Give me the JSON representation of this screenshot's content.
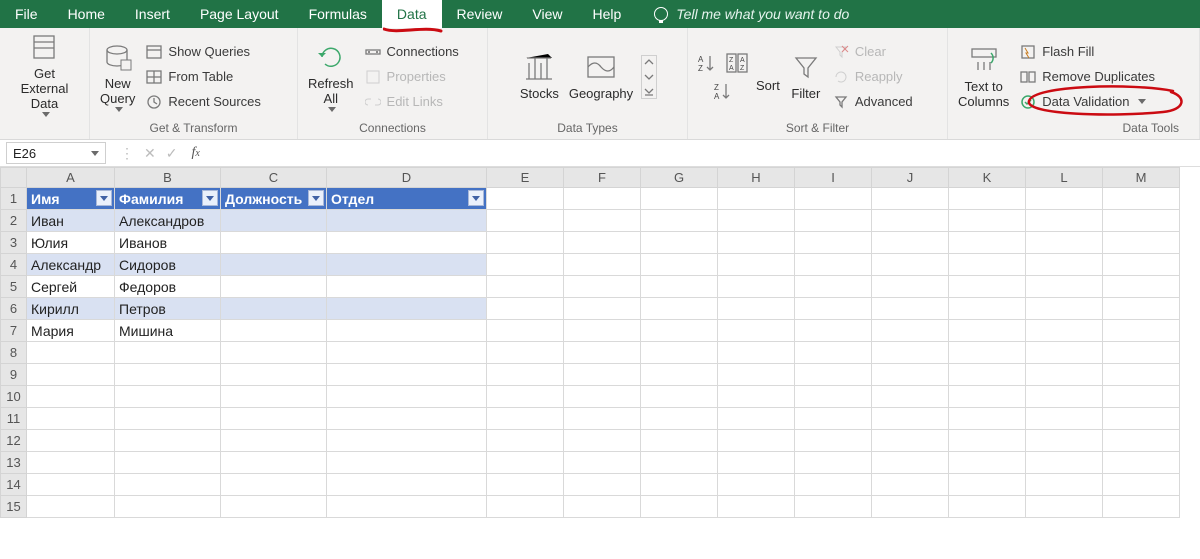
{
  "tabs": {
    "items": [
      "File",
      "Home",
      "Insert",
      "Page Layout",
      "Formulas",
      "Data",
      "Review",
      "View",
      "Help"
    ],
    "active": "Data",
    "tell_me": "Tell me what you want to do"
  },
  "ribbon": {
    "get_external": {
      "label": "Get External\nData",
      "caption": "Get External Data"
    },
    "get_transform": {
      "new_query": "New\nQuery",
      "show_queries": "Show Queries",
      "from_table": "From Table",
      "recent_sources": "Recent Sources",
      "group": "Get & Transform"
    },
    "connections": {
      "refresh_all": "Refresh\nAll",
      "connections": "Connections",
      "properties": "Properties",
      "edit_links": "Edit Links",
      "group": "Connections"
    },
    "data_types": {
      "stocks": "Stocks",
      "geography": "Geography",
      "group": "Data Types"
    },
    "sort_filter": {
      "sort": "Sort",
      "filter": "Filter",
      "clear": "Clear",
      "reapply": "Reapply",
      "advanced": "Advanced",
      "group": "Sort & Filter"
    },
    "data_tools": {
      "text_to_cols": "Text to\nColumns",
      "flash_fill": "Flash Fill",
      "remove_dup": "Remove Duplicates",
      "data_validation": "Data Validation",
      "group": "Data Tools"
    }
  },
  "name_box": "E26",
  "columns": [
    "A",
    "B",
    "C",
    "D",
    "E",
    "F",
    "G",
    "H",
    "I",
    "J",
    "K",
    "L",
    "M"
  ],
  "row_labels": [
    1,
    2,
    3,
    4,
    5,
    6,
    7,
    8,
    9,
    10,
    11,
    12,
    13,
    14,
    15
  ],
  "table": {
    "headers": [
      "Имя",
      "Фамилия",
      "Должность",
      "Отдел"
    ],
    "rows": [
      [
        "Иван",
        "Александров",
        "",
        ""
      ],
      [
        "Юлия",
        "Иванов",
        "",
        ""
      ],
      [
        "Александр",
        "Сидоров",
        "",
        ""
      ],
      [
        "Сергей",
        "Федоров",
        "",
        ""
      ],
      [
        "Кирилл",
        "Петров",
        "",
        ""
      ],
      [
        "Мария",
        "Мишина",
        "",
        ""
      ]
    ]
  }
}
